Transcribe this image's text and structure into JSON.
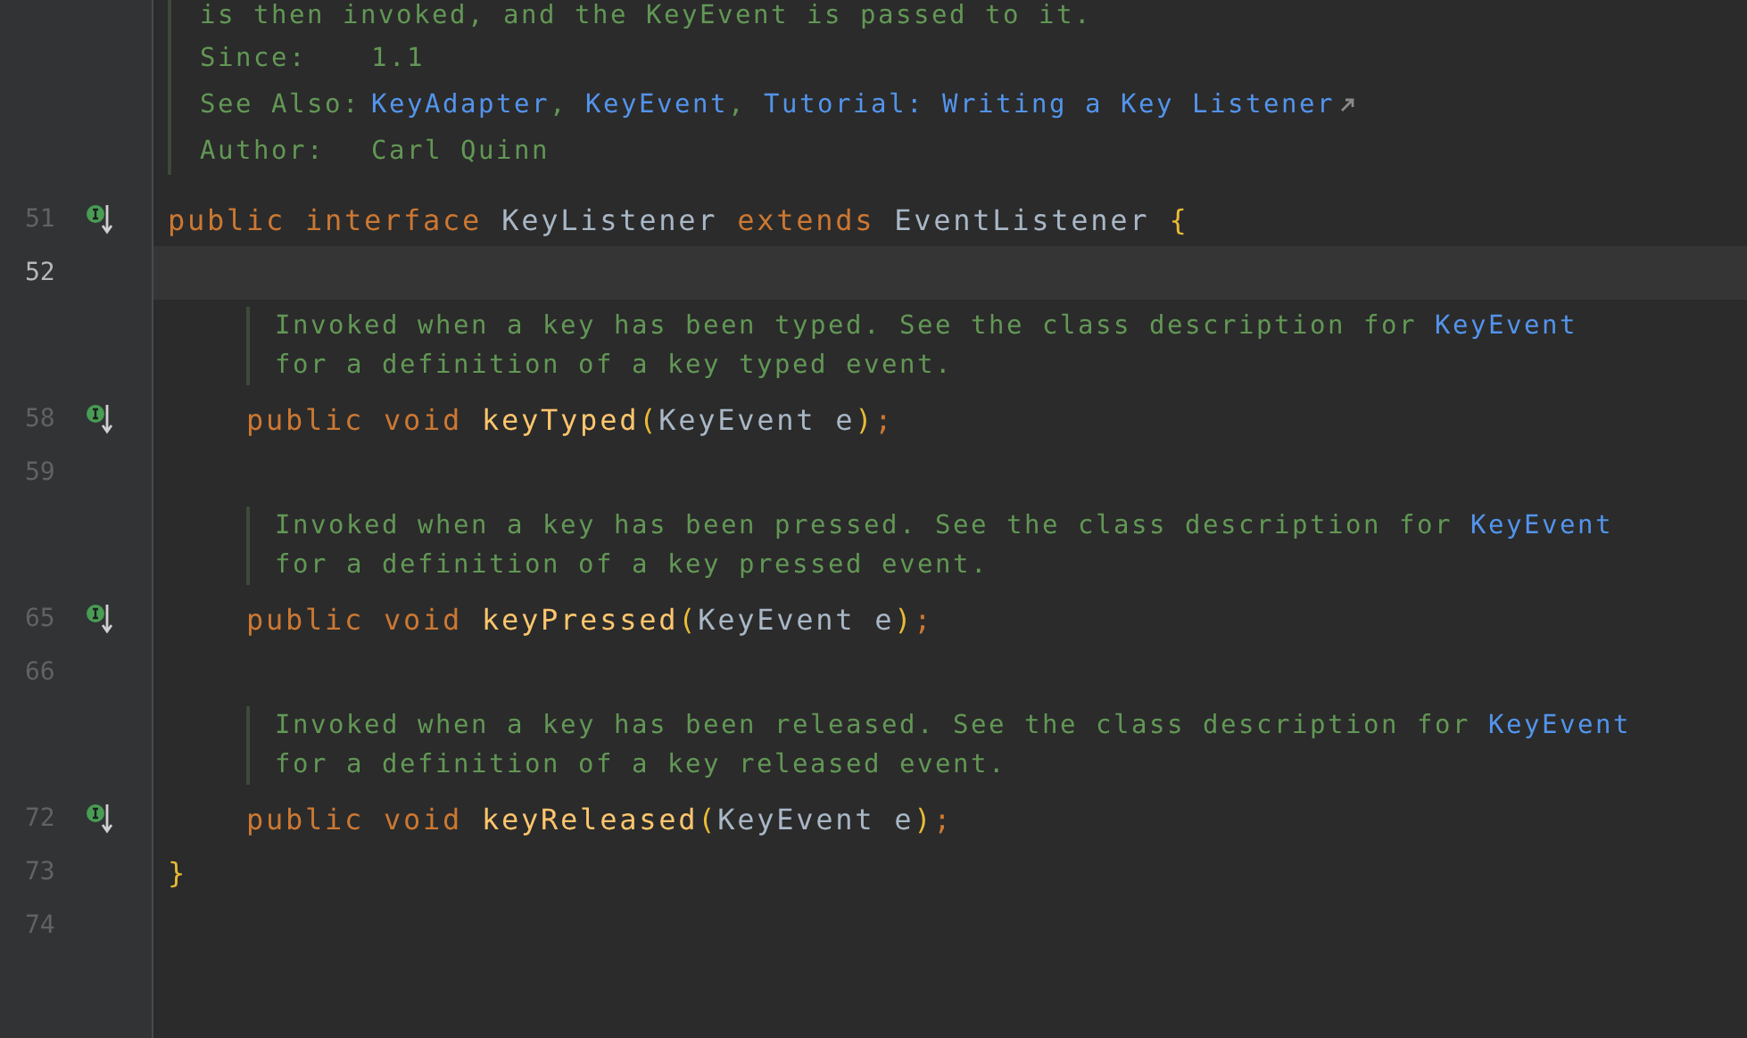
{
  "editor": {
    "rows": [
      {
        "kind": "doc_tags",
        "partial_line": "is then invoked, and the KeyEvent is passed to it.",
        "tags": [
          {
            "label": "Since:",
            "parts": [
              {
                "text": "1.1",
                "kind": "text"
              }
            ]
          },
          {
            "label": "See Also:",
            "parts": [
              {
                "text": "KeyAdapter",
                "kind": "link"
              },
              {
                "text": ",",
                "kind": "text"
              },
              {
                "text": "KeyEvent",
                "kind": "link"
              },
              {
                "text": ",",
                "kind": "text"
              },
              {
                "text": "Tutorial: Writing a Key Listener",
                "kind": "external_link"
              }
            ]
          },
          {
            "label": "Author:",
            "parts": [
              {
                "text": "Carl Quinn",
                "kind": "text"
              }
            ]
          }
        ]
      },
      {
        "kind": "code",
        "number": "51",
        "current": false,
        "has_implementations": true,
        "tokens": [
          {
            "text": "public ",
            "kind": "keyword"
          },
          {
            "text": "interface ",
            "kind": "keyword"
          },
          {
            "text": "KeyListener ",
            "kind": "plain"
          },
          {
            "text": "extends ",
            "kind": "keyword"
          },
          {
            "text": "EventListener ",
            "kind": "plain"
          },
          {
            "text": "{",
            "kind": "brace"
          }
        ],
        "children": [
          {
            "kind": "code",
            "number": "52",
            "current": true,
            "has_implementations": false
          },
          {
            "kind": "doc",
            "lines": [
              [
                {
                  "text": "Invoked when a key has been typed. See the class description for ",
                  "kind": "text"
                },
                {
                  "text": "KeyEvent",
                  "kind": "link"
                }
              ],
              [
                {
                  "text": "for a definition of a key typed event.",
                  "kind": "text"
                }
              ]
            ]
          },
          {
            "kind": "code",
            "number": "58",
            "current": false,
            "has_implementations": true,
            "tokens": [
              {
                "text": "public ",
                "kind": "keyword"
              },
              {
                "text": "void ",
                "kind": "keyword"
              },
              {
                "text": "keyTyped",
                "kind": "method"
              },
              {
                "text": "(",
                "kind": "brace"
              },
              {
                "text": "KeyEvent e",
                "kind": "plain"
              },
              {
                "text": ")",
                "kind": "brace"
              },
              {
                "text": ";",
                "kind": "keyword"
              }
            ]
          },
          {
            "kind": "code",
            "number": "59",
            "current": false,
            "has_implementations": false
          },
          {
            "kind": "doc",
            "lines": [
              [
                {
                  "text": "Invoked when a key has been pressed. See the class description for ",
                  "kind": "text"
                },
                {
                  "text": "KeyEvent",
                  "kind": "link"
                }
              ],
              [
                {
                  "text": "for a definition of a key pressed event.",
                  "kind": "text"
                }
              ]
            ]
          },
          {
            "kind": "code",
            "number": "65",
            "current": false,
            "has_implementations": true,
            "tokens": [
              {
                "text": "public ",
                "kind": "keyword"
              },
              {
                "text": "void ",
                "kind": "keyword"
              },
              {
                "text": "keyPressed",
                "kind": "method"
              },
              {
                "text": "(",
                "kind": "brace"
              },
              {
                "text": "KeyEvent e",
                "kind": "plain"
              },
              {
                "text": ")",
                "kind": "brace"
              },
              {
                "text": ";",
                "kind": "keyword"
              }
            ]
          },
          {
            "kind": "code",
            "number": "66",
            "current": false,
            "has_implementations": false
          },
          {
            "kind": "doc",
            "lines": [
              [
                {
                  "text": "Invoked when a key has been released. See the class description for ",
                  "kind": "text"
                },
                {
                  "text": "KeyEvent",
                  "kind": "link"
                }
              ],
              [
                {
                  "text": "for a definition of a key released event.",
                  "kind": "text"
                }
              ]
            ]
          },
          {
            "kind": "code",
            "number": "72",
            "current": false,
            "has_implementations": true,
            "tokens": [
              {
                "text": "public ",
                "kind": "keyword"
              },
              {
                "text": "void ",
                "kind": "keyword"
              },
              {
                "text": "keyReleased",
                "kind": "method"
              },
              {
                "text": "(",
                "kind": "brace"
              },
              {
                "text": "KeyEvent e",
                "kind": "plain"
              },
              {
                "text": ")",
                "kind": "brace"
              },
              {
                "text": ";",
                "kind": "keyword"
              }
            ]
          }
        ]
      },
      {
        "kind": "code",
        "number": "73",
        "current": false,
        "has_implementations": false,
        "tokens": [
          {
            "text": "}",
            "kind": "brace"
          }
        ]
      },
      {
        "kind": "code",
        "number": "74",
        "current": false,
        "has_implementations": false
      }
    ]
  }
}
